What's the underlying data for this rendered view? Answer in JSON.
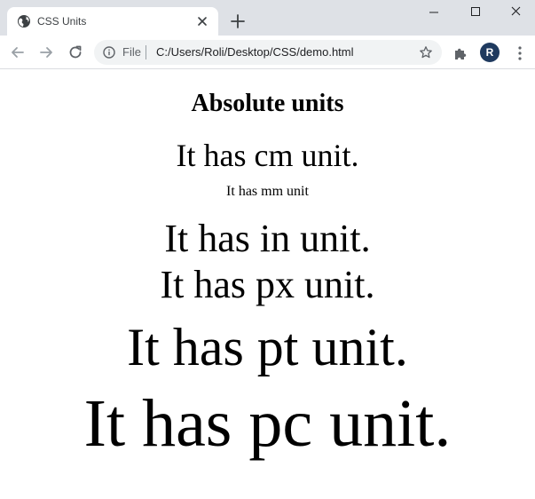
{
  "browser": {
    "tab": {
      "title": "CSS Units",
      "favicon": "globe-icon"
    },
    "address_bar": {
      "scheme_label": "File",
      "url": "C:/Users/Roli/Desktop/CSS/demo.html"
    },
    "profile_initial": "R",
    "accent": "#1f3a5f"
  },
  "page": {
    "heading": "Absolute units",
    "lines": {
      "cm": "It has cm unit.",
      "mm": "It has mm unit",
      "in": "It has in unit.",
      "px": "It has px unit.",
      "pt": "It has pt unit.",
      "pc": "It has pc unit."
    }
  }
}
